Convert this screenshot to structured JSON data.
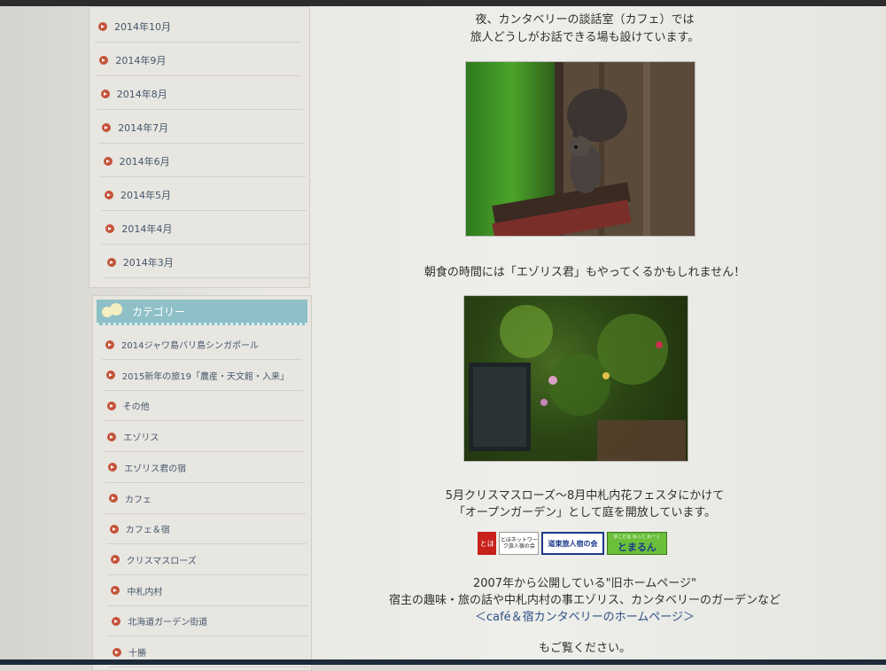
{
  "archive": {
    "items": [
      {
        "label": "2014年10月"
      },
      {
        "label": "2014年9月"
      },
      {
        "label": "2014年8月"
      },
      {
        "label": "2014年7月"
      },
      {
        "label": "2014年6月"
      },
      {
        "label": "2014年5月"
      },
      {
        "label": "2014年4月"
      },
      {
        "label": "2014年3月"
      }
    ]
  },
  "categories": {
    "header": "カテゴリー",
    "items": [
      {
        "label": "2014ジャワ島バリ島シンガポール"
      },
      {
        "label": "2015新年の旅19「農産・天文館・入来」"
      },
      {
        "label": "その他"
      },
      {
        "label": "エゾリス"
      },
      {
        "label": "エゾリス君の宿"
      },
      {
        "label": "カフェ"
      },
      {
        "label": "カフェ＆宿"
      },
      {
        "label": "クリスマスローズ"
      },
      {
        "label": "中札内村"
      },
      {
        "label": "北海道ガーデン街道"
      },
      {
        "label": "十勝"
      }
    ]
  },
  "main": {
    "intro_line1": "夜、カンタベリーの談話室（カフェ）では",
    "intro_line2": "旅人どうしがお話できる場も設けています。",
    "squirrel_caption": "朝食の時間には「エゾリス君」もやってくるかもしれません！",
    "garden_line1": "5月クリスマスローズ～8月中札内花フェスタにかけて",
    "garden_line2": "「オープンガーデン」として庭を開放しています。",
    "banner1_mark": "とほ",
    "banner1_text": "とほネットワーク旅人宿の会",
    "banner2_text": "道東旅人宿の会",
    "banner3_top": "ゆこどは ねっと わーく",
    "banner3_text": "とまるん",
    "hp_line1": "2007年から公開している\"旧ホームページ\"",
    "hp_line2": "宿主の趣味・旅の話や中札内村の事エゾリス、カンタベリーのガーデンなど",
    "hp_link": "＜café＆宿カンタベリーのホームページ＞",
    "hp_line3": "もご覧ください。"
  },
  "colors": {
    "bullet": "#c4533a",
    "category_header": "#8fc0c7",
    "link": "#2d4f86"
  }
}
